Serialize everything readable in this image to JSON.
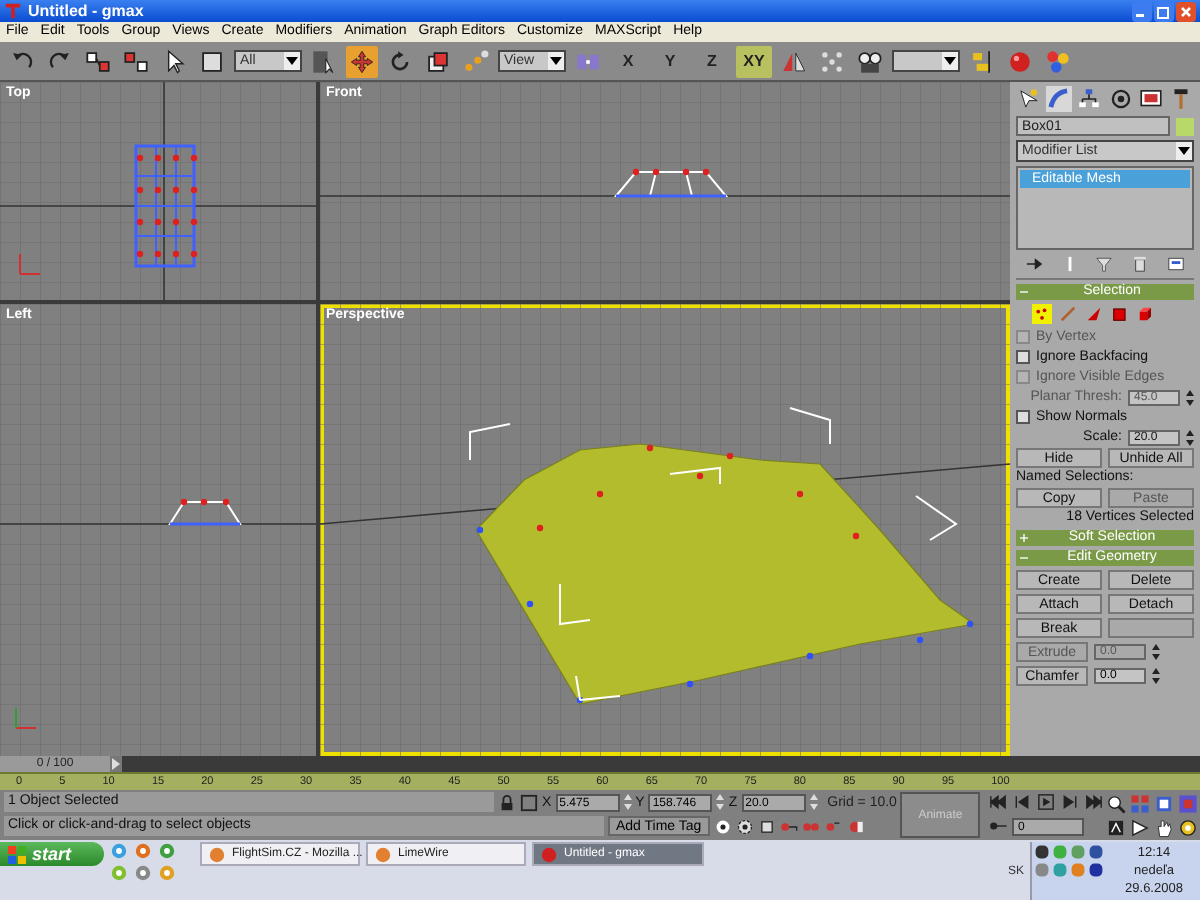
{
  "window": {
    "title": "Untitled - gmax"
  },
  "menu": [
    "File",
    "Edit",
    "Tools",
    "Group",
    "Views",
    "Create",
    "Modifiers",
    "Animation",
    "Graph Editors",
    "Customize",
    "MAXScript",
    "Help"
  ],
  "toolbar": [
    {
      "kind": "undo",
      "selected": false
    },
    {
      "kind": "redo",
      "selected": false
    },
    {
      "kind": "link",
      "selected": false
    },
    {
      "kind": "unlink",
      "selected": false
    },
    {
      "kind": "select",
      "selected": false
    },
    {
      "kind": "region",
      "selected": false
    },
    {
      "kind": "dropdown",
      "value": "All"
    },
    {
      "kind": "selectname",
      "selected": false
    },
    {
      "kind": "move",
      "selected": true
    },
    {
      "kind": "rotate",
      "selected": false
    },
    {
      "kind": "scale",
      "selected": false
    },
    {
      "kind": "snap",
      "selected": false
    },
    {
      "kind": "dropdown",
      "value": "View"
    },
    {
      "kind": "pivot",
      "selected": false
    },
    {
      "kind": "letter",
      "label": "X",
      "selected": false
    },
    {
      "kind": "letter",
      "label": "Y",
      "selected": false
    },
    {
      "kind": "letter",
      "label": "Z",
      "selected": false
    },
    {
      "kind": "letter",
      "label": "XY",
      "selected": true
    },
    {
      "kind": "mirror",
      "selected": false
    },
    {
      "kind": "array",
      "selected": false
    },
    {
      "kind": "camera",
      "selected": false
    },
    {
      "kind": "dropdown"
    },
    {
      "kind": "align",
      "selected": false
    },
    {
      "kind": "material",
      "selected": false
    },
    {
      "kind": "render",
      "selected": false
    }
  ],
  "viewports": [
    {
      "label": "Top",
      "kind": "top",
      "active": false
    },
    {
      "label": "Front",
      "kind": "front",
      "active": false
    },
    {
      "label": "Left",
      "kind": "left",
      "active": false
    },
    {
      "label": "Perspective",
      "kind": "perspective",
      "active": true
    }
  ],
  "command_panel": {
    "tabs": [
      {
        "kind": "create",
        "selected": false
      },
      {
        "kind": "modify",
        "selected": true
      },
      {
        "kind": "hierarchy",
        "selected": false
      },
      {
        "kind": "motion",
        "selected": false
      },
      {
        "kind": "display",
        "selected": false
      },
      {
        "kind": "utilities",
        "selected": false
      }
    ],
    "object_name": "Box01",
    "modifier_list": "Modifier List",
    "stack": [
      {
        "label": "Editable Mesh",
        "selected": true
      }
    ],
    "selection": {
      "title": "Selection",
      "expanded": true,
      "levels": [
        {
          "kind": "vertex",
          "selected": true
        },
        {
          "kind": "edge",
          "selected": false
        },
        {
          "kind": "face",
          "selected": false
        },
        {
          "kind": "polygon",
          "selected": false
        },
        {
          "kind": "element",
          "selected": false
        }
      ],
      "options": [
        {
          "kind": "checkbox",
          "label": "By Vertex",
          "checked": false,
          "disabled": true
        },
        {
          "kind": "checkbox",
          "label": "Ignore Backfacing",
          "checked": false,
          "disabled": false
        },
        {
          "kind": "checkbox",
          "label": "Ignore Visible Edges",
          "checked": false,
          "disabled": true
        },
        {
          "kind": "spinner",
          "label": "Planar Thresh:",
          "value": "45.0",
          "disabled": true
        },
        {
          "kind": "checkbox",
          "label": "Show Normals",
          "checked": false,
          "disabled": false
        },
        {
          "kind": "spinner",
          "label": "Scale:",
          "value": "20.0",
          "disabled": false
        }
      ],
      "buttons": [
        {
          "label": "Hide",
          "disabled": false
        },
        {
          "label": "Unhide All",
          "disabled": false
        }
      ],
      "named_label": "Named Selections:",
      "named_buttons": [
        {
          "label": "Copy",
          "disabled": false
        },
        {
          "label": "Paste",
          "disabled": true
        }
      ],
      "status": "18 Vertices Selected"
    },
    "rollouts": [
      {
        "title": "Soft Selection",
        "expanded": false
      },
      {
        "title": "Edit Geometry",
        "expanded": true
      }
    ],
    "geometry_buttons": [
      {
        "label": "Create",
        "disabled": false
      },
      {
        "label": "Delete",
        "disabled": false
      },
      {
        "label": "Attach",
        "disabled": false
      },
      {
        "label": "Detach",
        "disabled": false
      },
      {
        "label": "Break",
        "disabled": false
      },
      {
        "disabled": true
      }
    ],
    "geometry_spinners": [
      {
        "label": "Extrude",
        "value": "0.0",
        "disabled": true
      },
      {
        "label": "Chamfer",
        "value": "0.0",
        "disabled": false
      }
    ]
  },
  "time_slider": {
    "label": "0 / 100"
  },
  "track_bar": {
    "ticks": [
      "0",
      "5",
      "10",
      "15",
      "20",
      "25",
      "30",
      "35",
      "40",
      "45",
      "50",
      "55",
      "60",
      "65",
      "70",
      "75",
      "80",
      "85",
      "90",
      "95",
      "100"
    ]
  },
  "status": {
    "selection": "1 Object Selected",
    "prompt": "Click or click-and-drag to select objects",
    "coords": [
      {
        "axis": "X",
        "value": "5.475"
      },
      {
        "axis": "Y",
        "value": "158.746"
      },
      {
        "axis": "Z",
        "value": "20.0"
      }
    ],
    "grid": "Grid = 10.0",
    "time_tag": "Add Time Tag",
    "animate": {
      "label": "Animate",
      "on": false
    },
    "frame": "0"
  },
  "taskbar": {
    "start": "start",
    "tasks": [
      {
        "label": "FlightSim.CZ - Mozilla ...",
        "selected": false
      },
      {
        "label": "LimeWire",
        "selected": false
      },
      {
        "label": "Untitled - gmax",
        "selected": true
      }
    ],
    "language": "SK",
    "time": "12:14",
    "day": "nedeľa",
    "date": "29.6.2008"
  }
}
